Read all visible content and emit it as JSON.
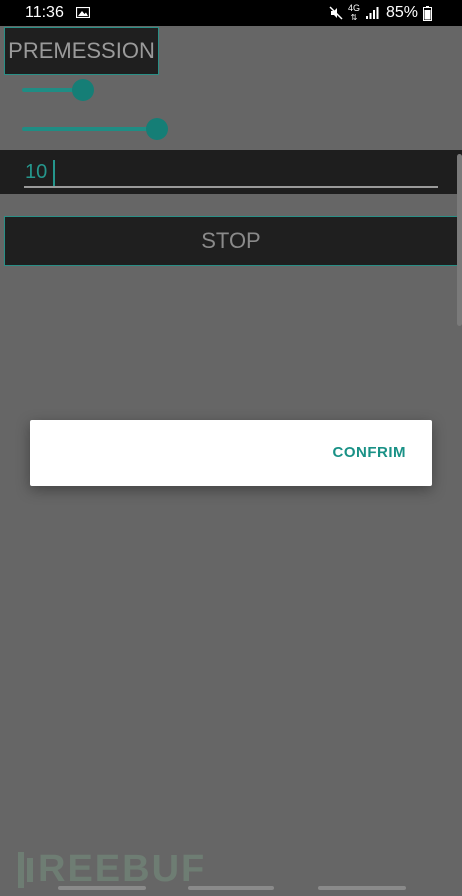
{
  "status_bar": {
    "time": "11:36",
    "network": "4G",
    "battery_percent": "85%",
    "icons": [
      "gallery-icon",
      "mute-icon",
      "network-icon",
      "signal-icon",
      "battery-icon"
    ]
  },
  "main": {
    "permission_button": "PREMESSION",
    "slider_1": {
      "value_fraction": 0.18
    },
    "slider_2": {
      "value_fraction": 0.48
    },
    "input_value": "10",
    "stop_button": "STOP"
  },
  "dialog": {
    "confirm_label": "CONFRIM"
  },
  "watermark": {
    "text": "REEBUF"
  },
  "colors": {
    "accent": "#1f8d84",
    "overlay": "#666666",
    "dark_surface": "#1f1f1f"
  }
}
